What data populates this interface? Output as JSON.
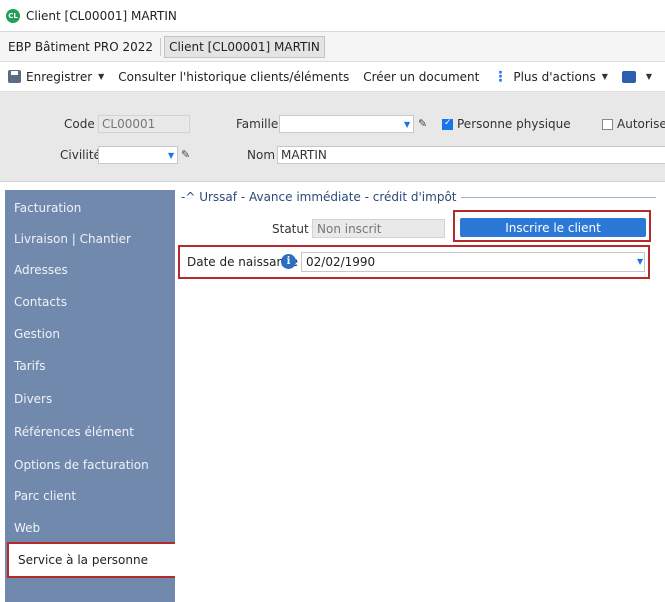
{
  "window": {
    "badge": "CL",
    "title": "Client [CL00001] MARTIN"
  },
  "breadcrumb": [
    "EBP Bâtiment PRO 2022",
    "Client [CL00001] MARTIN"
  ],
  "toolbar": {
    "save": "Enregistrer",
    "history": "Consulter l'historique clients/éléments",
    "create_doc": "Créer un document",
    "more": "Plus d'actions"
  },
  "header": {
    "code_label": "Code",
    "code_value": "CL00001",
    "famille_label": "Famille",
    "famille_value": "",
    "personne_physique_label": "Personne physique",
    "personne_physique_checked": true,
    "autorise_label": "Autorise",
    "civilite_label": "Civilité",
    "civilite_value": "",
    "nom_label": "Nom",
    "nom_value": "MARTIN"
  },
  "sidebar": {
    "items": [
      "Facturation",
      "Livraison | Chantier",
      "Adresses",
      "Contacts",
      "Gestion",
      "Tarifs",
      "Divers",
      "Références élément",
      "Options de facturation",
      "Parc client",
      "Web",
      "Service à la personne"
    ],
    "active_index": 11
  },
  "urssaf": {
    "group_title": "Urssaf - Avance immédiate - crédit d'impôt",
    "statut_label": "Statut",
    "statut_value": "Non inscrit",
    "inscrire_button": "Inscrire le client",
    "dob_label": "Date de naissance",
    "dob_value": "02/02/1990"
  },
  "colors": {
    "sidebar_bg": "#7189ad",
    "highlight_border": "#b52a2a",
    "primary_button": "#2b78d6"
  }
}
